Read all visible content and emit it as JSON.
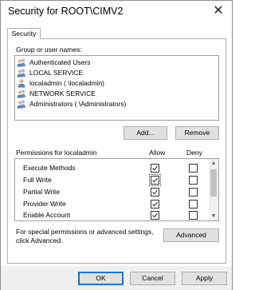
{
  "window": {
    "title": "Security for ROOT\\CIMV2",
    "close_glyph": "✕"
  },
  "tabs": [
    {
      "label": "Security"
    }
  ],
  "groups": {
    "label": "Group or user names:",
    "items": [
      {
        "label": "Authenticated Users",
        "icon": "users-icon"
      },
      {
        "label": "LOCAL SERVICE",
        "icon": "users-icon"
      },
      {
        "label": "localadmin (                  \\localadmin)",
        "icon": "user-icon"
      },
      {
        "label": "NETWORK SERVICE",
        "icon": "users-icon"
      },
      {
        "label": "Administrators (                  \\Administrators)",
        "icon": "users-icon"
      }
    ],
    "add_label": "Add...",
    "remove_label": "Remove"
  },
  "permissions": {
    "label": "Permissions for localadmin",
    "allow_header": "Allow",
    "deny_header": "Deny",
    "rows": [
      {
        "name": "Execute Methods",
        "allow": true,
        "deny": false
      },
      {
        "name": "Full Write",
        "allow": true,
        "deny": false
      },
      {
        "name": "Partial Write",
        "allow": true,
        "deny": false
      },
      {
        "name": "Provider Write",
        "allow": true,
        "deny": false
      },
      {
        "name": "Enable Account",
        "allow": true,
        "deny": false
      }
    ]
  },
  "advanced": {
    "text_line1": "For special permissions or advanced settings,",
    "text_line2": "click Advanced.",
    "button_label": "Advanced"
  },
  "footer": {
    "ok_label": "OK",
    "cancel_label": "Cancel",
    "apply_label": "Apply"
  }
}
